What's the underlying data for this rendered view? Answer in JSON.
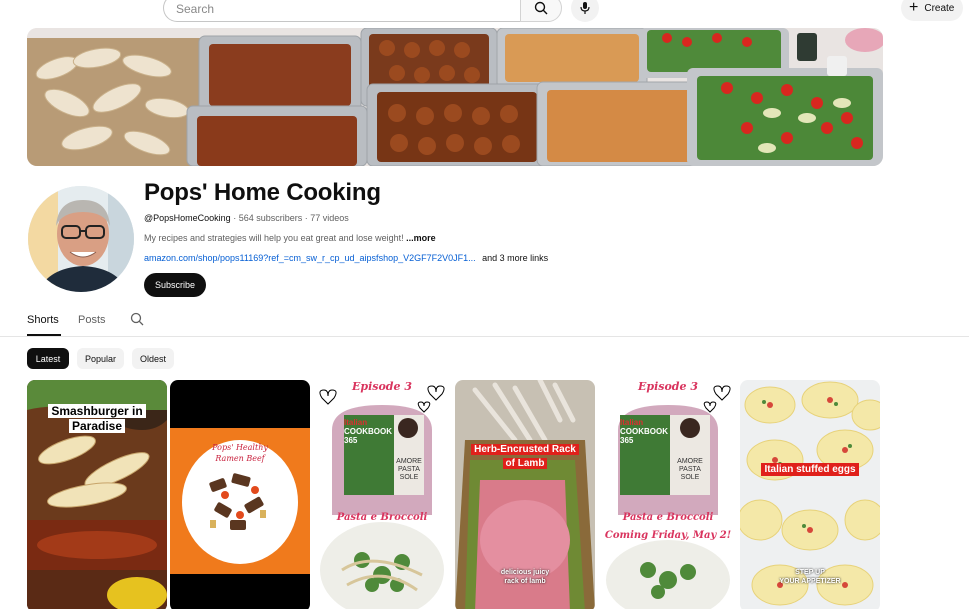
{
  "topbar": {
    "search_placeholder": "Search",
    "create_label": "Create"
  },
  "channel": {
    "name": "Pops' Home Cooking",
    "handle": "@PopsHomeCooking",
    "subscribers": "564 subscribers",
    "videos": "77 videos",
    "separator": " · ",
    "description": "My recipes and strategies will help you eat great and lose weight!",
    "more_label": "...more",
    "link": "amazon.com/shop/pops11169?ref_=cm_sw_r_cp_ud_aipsfshop_V2GF7F2V0JF1...",
    "more_links": "and 3 more links",
    "subscribe_label": "Subscribe"
  },
  "tabs": [
    {
      "label": "Shorts",
      "active": true
    },
    {
      "label": "Posts",
      "active": false
    }
  ],
  "filters": [
    {
      "label": "Latest",
      "active": true
    },
    {
      "label": "Popular",
      "active": false
    },
    {
      "label": "Oldest",
      "active": false
    }
  ],
  "shorts": [
    {
      "caption_lines": [
        "Smashburger in",
        "Paradise"
      ]
    },
    {
      "caption_lines": [
        "Pops' Healthy",
        "Ramen Beef"
      ]
    },
    {
      "top_label": "Episode 3",
      "book_title": [
        "Italian",
        "COOKBOOK"
      ],
      "book_number": "365",
      "book_words": [
        "AMORE",
        "PASTA",
        "SOLE"
      ],
      "bottom_label": "Pasta e Broccoli"
    },
    {
      "caption_lines": [
        "Herb-Encrusted Rack",
        "of Lamb"
      ],
      "subcaption_lines": [
        "delicious juicy",
        "rack of lamb"
      ]
    },
    {
      "top_label": "Episode 3",
      "book_title": [
        "Italian",
        "COOKBOOK"
      ],
      "book_number": "365",
      "book_words": [
        "AMORE",
        "PASTA",
        "SOLE"
      ],
      "bottom_label": "Pasta e Broccoli",
      "extra_label": "Coming Friday, May 2!"
    },
    {
      "caption_lines": [
        "Italian stuffed eggs"
      ],
      "subcaption_lines": [
        "STEP UP",
        "YOUR APPETIZER"
      ]
    }
  ],
  "colors": {
    "accent": "#0f0f0f",
    "link": "#065fd4",
    "caption_red": "#e0201b",
    "episode_pink": "#d9345e"
  }
}
